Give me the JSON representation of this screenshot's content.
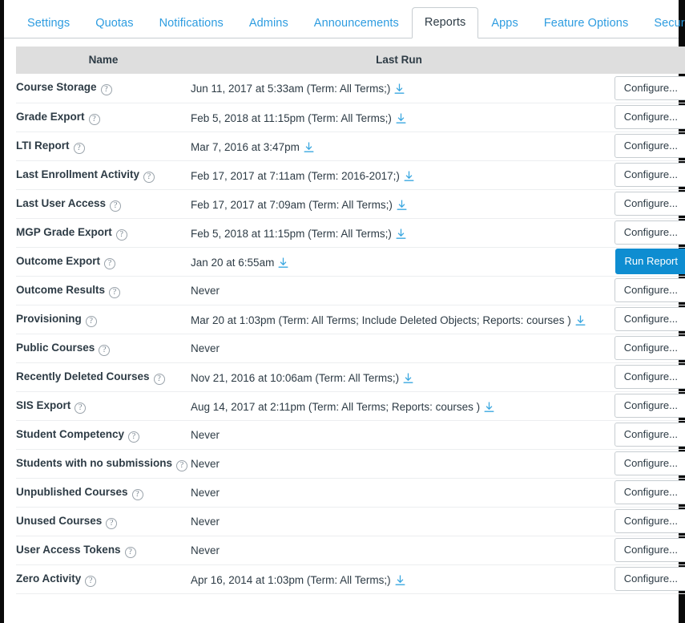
{
  "tabs": [
    {
      "label": "Settings",
      "active": false
    },
    {
      "label": "Quotas",
      "active": false
    },
    {
      "label": "Notifications",
      "active": false
    },
    {
      "label": "Admins",
      "active": false
    },
    {
      "label": "Announcements",
      "active": false
    },
    {
      "label": "Reports",
      "active": true
    },
    {
      "label": "Apps",
      "active": false
    },
    {
      "label": "Feature Options",
      "active": false
    },
    {
      "label": "Security",
      "active": false
    }
  ],
  "table": {
    "columns": [
      "Name",
      "Last Run"
    ],
    "help_icon": "?",
    "download_icon": "download-icon",
    "configure_label": "Configure...",
    "run_label": "Run Report",
    "never_label": "Never",
    "rows": [
      {
        "name": "Course Storage",
        "last_run": "Jun 11, 2017 at 5:33am (Term: All Terms;)",
        "has_download": true,
        "action": "Configure...",
        "action_type": "configure"
      },
      {
        "name": "Grade Export",
        "last_run": "Feb 5, 2018 at 11:15pm (Term: All Terms;)",
        "has_download": true,
        "action": "Configure...",
        "action_type": "configure"
      },
      {
        "name": "LTI Report",
        "last_run": "Mar 7, 2016 at 3:47pm",
        "has_download": true,
        "action": "Configure...",
        "action_type": "configure"
      },
      {
        "name": "Last Enrollment Activity",
        "last_run": "Feb 17, 2017 at 7:11am (Term: 2016-2017;)",
        "has_download": true,
        "action": "Configure...",
        "action_type": "configure"
      },
      {
        "name": "Last User Access",
        "last_run": "Feb 17, 2017 at 7:09am (Term: All Terms;)",
        "has_download": true,
        "action": "Configure...",
        "action_type": "configure"
      },
      {
        "name": "MGP Grade Export",
        "last_run": "Feb 5, 2018 at 11:15pm (Term: All Terms;)",
        "has_download": true,
        "action": "Configure...",
        "action_type": "configure"
      },
      {
        "name": "Outcome Export",
        "last_run": "Jan 20 at 6:55am",
        "has_download": true,
        "action": "Run Report",
        "action_type": "run",
        "tall": true
      },
      {
        "name": "Outcome Results",
        "last_run": "Never",
        "has_download": false,
        "action": "Configure...",
        "action_type": "configure"
      },
      {
        "name": "Provisioning",
        "last_run": "Mar 20 at 1:03pm (Term: All Terms; Include Deleted Objects; Reports: courses )",
        "has_download": true,
        "action": "Configure...",
        "action_type": "configure"
      },
      {
        "name": "Public Courses",
        "last_run": "Never",
        "has_download": false,
        "action": "Configure...",
        "action_type": "configure"
      },
      {
        "name": "Recently Deleted Courses",
        "last_run": "Nov 21, 2016 at 10:06am (Term: All Terms;)",
        "has_download": true,
        "action": "Configure...",
        "action_type": "configure"
      },
      {
        "name": "SIS Export",
        "last_run": "Aug 14, 2017 at 2:11pm (Term: All Terms; Reports: courses )",
        "has_download": true,
        "action": "Configure...",
        "action_type": "configure"
      },
      {
        "name": "Student Competency",
        "last_run": "Never",
        "has_download": false,
        "action": "Configure...",
        "action_type": "configure"
      },
      {
        "name": "Students with no submissions",
        "last_run": "Never",
        "has_download": false,
        "action": "Configure...",
        "action_type": "configure"
      },
      {
        "name": "Unpublished Courses",
        "last_run": "Never",
        "has_download": false,
        "action": "Configure...",
        "action_type": "configure"
      },
      {
        "name": "Unused Courses",
        "last_run": "Never",
        "has_download": false,
        "action": "Configure...",
        "action_type": "configure"
      },
      {
        "name": "User Access Tokens",
        "last_run": "Never",
        "has_download": false,
        "action": "Configure...",
        "action_type": "configure"
      },
      {
        "name": "Zero Activity",
        "last_run": "Apr 16, 2014 at 1:03pm (Term: All Terms;)",
        "has_download": true,
        "action": "Configure...",
        "action_type": "configure"
      }
    ]
  },
  "colors": {
    "link": "#2d9ce0",
    "primary_button": "#0e8dd1",
    "text": "#2d3b45",
    "header_bg": "#dedede",
    "row_divider": "#eceef0",
    "border": "#c7cdd1"
  }
}
